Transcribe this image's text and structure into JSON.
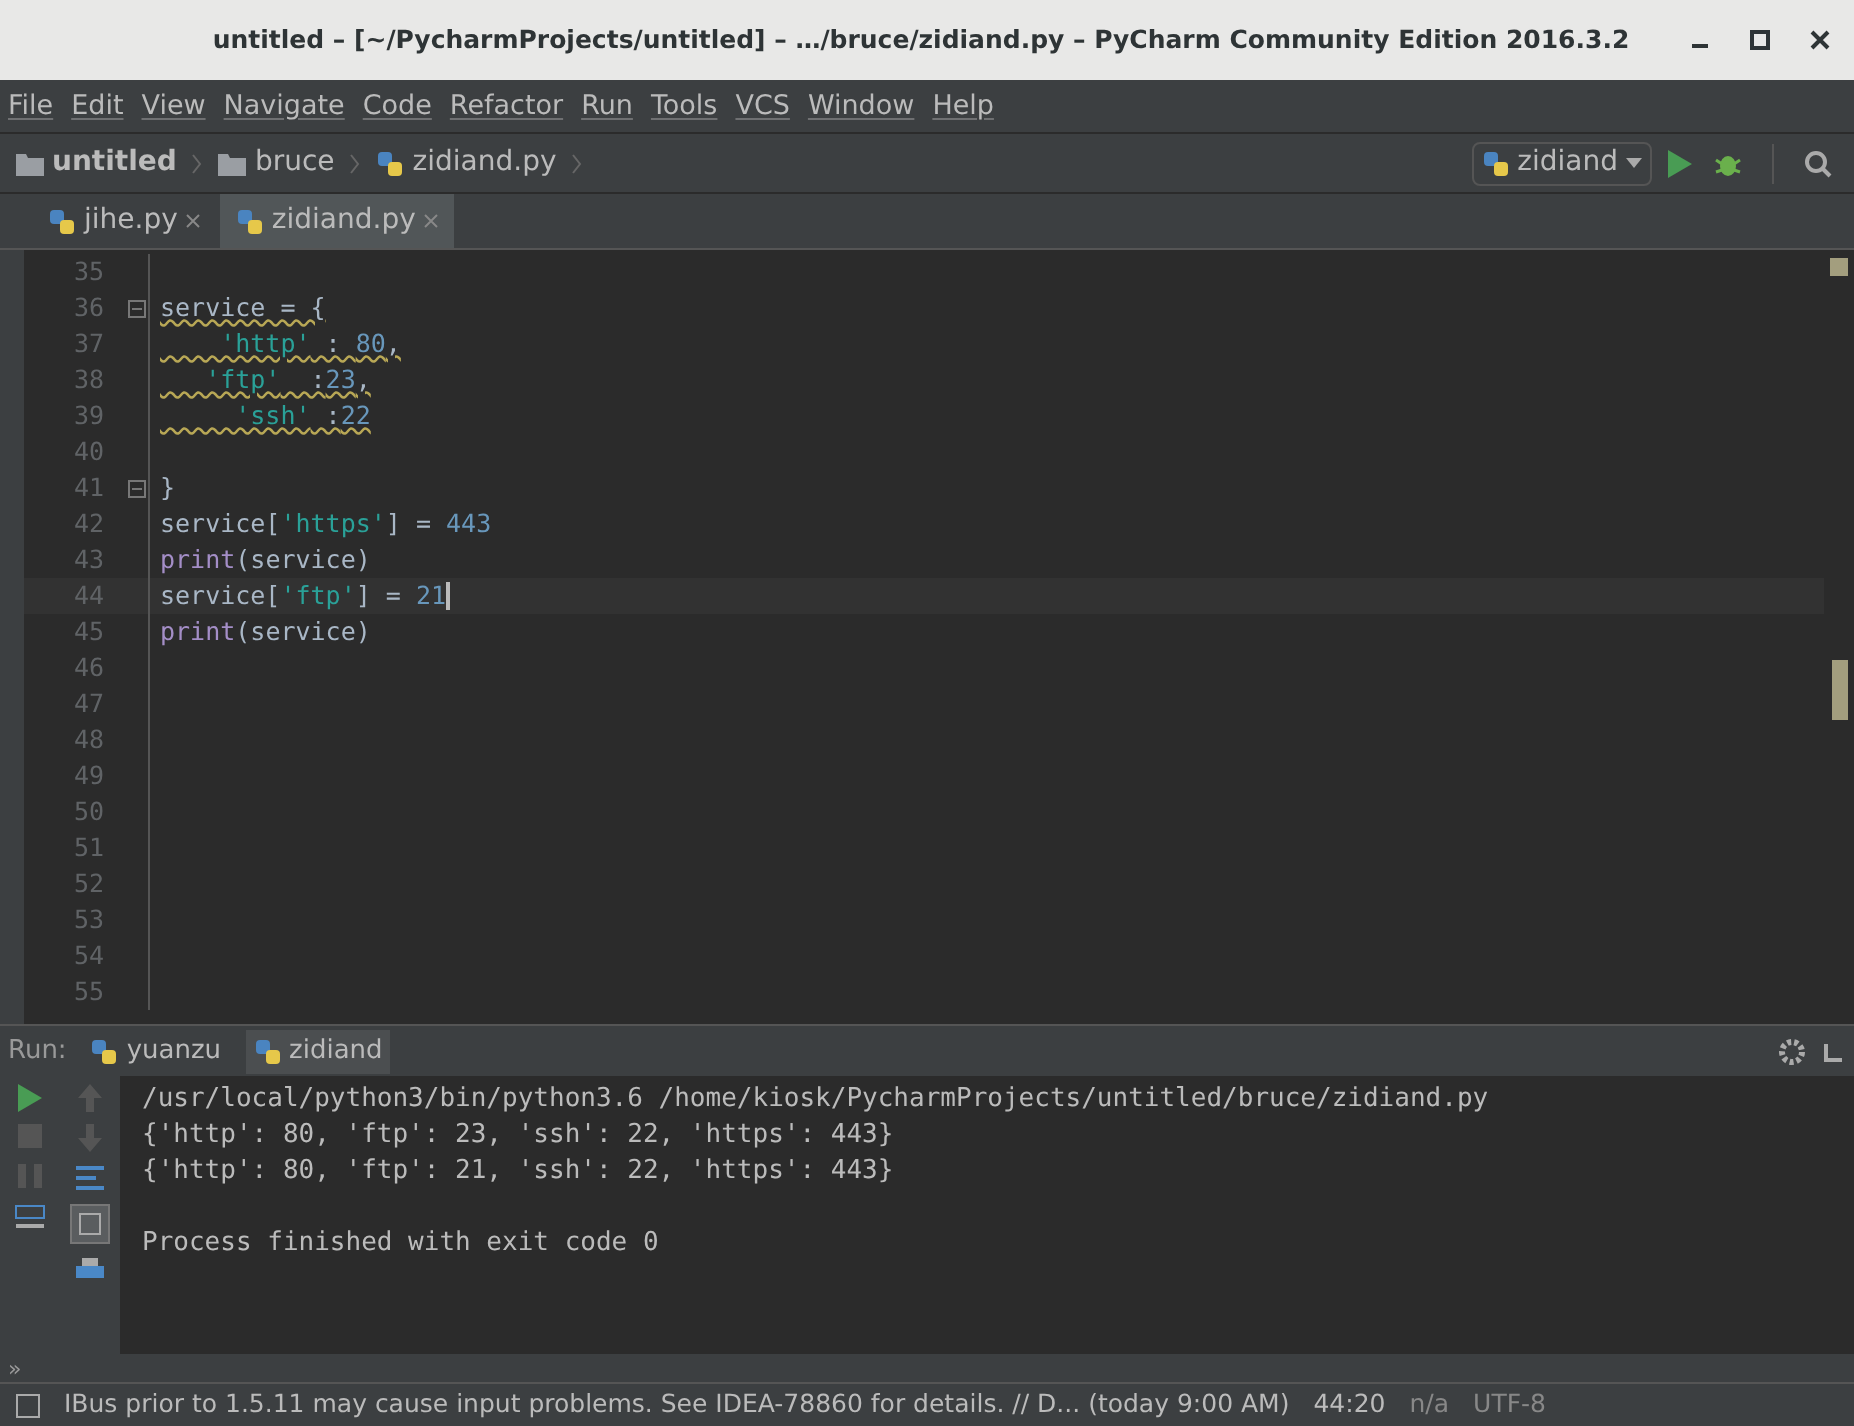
{
  "window": {
    "title": "untitled – [~/PycharmProjects/untitled] – …/bruce/zidiand.py – PyCharm Community Edition 2016.3.2"
  },
  "menu": [
    "File",
    "Edit",
    "View",
    "Navigate",
    "Code",
    "Refactor",
    "Run",
    "Tools",
    "VCS",
    "Window",
    "Help"
  ],
  "breadcrumbs": [
    {
      "label": "untitled",
      "kind": "project"
    },
    {
      "label": "bruce",
      "kind": "folder"
    },
    {
      "label": "zidiand.py",
      "kind": "file"
    }
  ],
  "run_config": {
    "label": "zidiand"
  },
  "tabs": [
    {
      "label": "jihe.py",
      "selected": false
    },
    {
      "label": "zidiand.py",
      "selected": true
    }
  ],
  "editor": {
    "lines": [
      {
        "number": "35"
      },
      {
        "number": "36",
        "fold": true,
        "warn": true,
        "tokens": [
          {
            "kind": "plain",
            "text": "service = {"
          }
        ]
      },
      {
        "number": "37",
        "warn": true,
        "tokens": [
          {
            "kind": "string",
            "text": "    'http'"
          },
          {
            "kind": "plain",
            "text": " : "
          },
          {
            "kind": "number",
            "text": "80"
          },
          {
            "kind": "plain",
            "text": ","
          }
        ]
      },
      {
        "number": "38",
        "warn": true,
        "tokens": [
          {
            "kind": "string",
            "text": "   'ftp'"
          },
          {
            "kind": "plain",
            "text": "  :"
          },
          {
            "kind": "number",
            "text": "23"
          },
          {
            "kind": "plain",
            "text": ","
          }
        ]
      },
      {
        "number": "39",
        "warn": true,
        "tokens": [
          {
            "kind": "string",
            "text": "     'ssh'"
          },
          {
            "kind": "plain",
            "text": " :"
          },
          {
            "kind": "number",
            "text": "22"
          }
        ]
      },
      {
        "number": "40"
      },
      {
        "number": "41",
        "fold": true,
        "tokens": [
          {
            "kind": "plain",
            "text": "}"
          }
        ]
      },
      {
        "number": "42",
        "tokens": [
          {
            "kind": "plain",
            "text": "service["
          },
          {
            "kind": "string",
            "text": "'https'"
          },
          {
            "kind": "plain",
            "text": "] = "
          },
          {
            "kind": "number",
            "text": "443"
          }
        ]
      },
      {
        "number": "43",
        "tokens": [
          {
            "kind": "builtin",
            "text": "print"
          },
          {
            "kind": "plain",
            "text": "(service)"
          }
        ]
      },
      {
        "number": "44",
        "current": true,
        "tokens": [
          {
            "kind": "plain",
            "text": "service["
          },
          {
            "kind": "string",
            "text": "'ftp'"
          },
          {
            "kind": "plain",
            "text": "] = "
          },
          {
            "kind": "number",
            "text": "21"
          }
        ]
      },
      {
        "number": "45",
        "tokens": [
          {
            "kind": "builtin",
            "text": "print"
          },
          {
            "kind": "plain",
            "text": "(service)"
          }
        ]
      },
      {
        "number": "46"
      },
      {
        "number": "47"
      },
      {
        "number": "48"
      },
      {
        "number": "49"
      },
      {
        "number": "50"
      },
      {
        "number": "51"
      },
      {
        "number": "52"
      },
      {
        "number": "53"
      },
      {
        "number": "54"
      },
      {
        "number": "55"
      }
    ]
  },
  "run_panel": {
    "label": "Run:",
    "tabs": [
      {
        "label": "yuanzu",
        "selected": false
      },
      {
        "label": "zidiand",
        "selected": true
      }
    ],
    "output": [
      "/usr/local/python3/bin/python3.6 /home/kiosk/PycharmProjects/untitled/bruce/zidiand.py",
      "{'http': 80, 'ftp': 23, 'ssh': 22, 'https': 443}",
      "{'http': 80, 'ftp': 21, 'ssh': 22, 'https': 443}"
    ],
    "exit_message": "Process finished with exit code 0",
    "more": "»"
  },
  "status_bar": {
    "message": "IBus prior to 1.5.11 may cause input problems. See IDEA-78860 for details. // D... (today 9:00 AM)",
    "position": "44:20",
    "separator": "n/a",
    "encoding": "UTF-8"
  }
}
